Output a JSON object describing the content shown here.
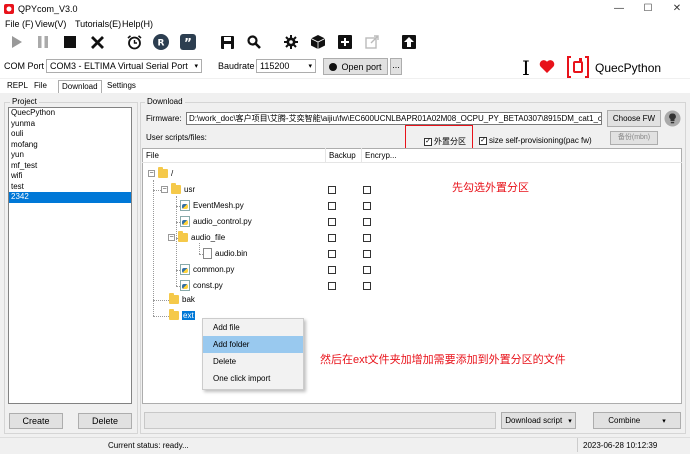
{
  "window": {
    "title": "QPYcom_V3.0",
    "controls": [
      "minimize-icon",
      "maximize-icon",
      "close-icon"
    ]
  },
  "menu": [
    "File (F)",
    "View(V)",
    "Tutorials(E)",
    "Help(H)"
  ],
  "toolbar": {
    "icons": [
      "run-icon",
      "pause-icon",
      "stop-icon",
      "clear-icon",
      "alarm-clock-icon",
      "terminal-icon",
      "quote-icon",
      "save-icon",
      "search-icon",
      "gear-icon",
      "cube-icon",
      "add-icon",
      "export-icon",
      "upload-icon"
    ]
  },
  "connection": {
    "com_port_label": "COM Port",
    "com_port_value": "COM3 - ELTIMA Virtual Serial Port",
    "baudrate_label": "Baudrate",
    "baudrate_value": "115200",
    "open_port_label": "Open port",
    "more_label": "..."
  },
  "brand": {
    "name": "QuecPython",
    "cursor_glyph": "I",
    "accent": "#e8121a"
  },
  "tabs": [
    "REPL",
    "File",
    "Download",
    "Settings"
  ],
  "active_tab": "Download",
  "project": {
    "group_title": "Project",
    "items": [
      "QuecPython",
      "yunma",
      "ouli",
      "mofang",
      "yun",
      "mf_test",
      "wifi",
      "test",
      "2342"
    ],
    "selected": "2342",
    "create_label": "Create",
    "delete_label": "Delete"
  },
  "download": {
    "group_title": "Download",
    "firmware_label": "Firmware:",
    "firmware_value": "D:\\work_doc\\客户项目\\艾腾-艾奕智能\\aijiu\\fw\\EC600UCNLBAPR01A02M08_OCPU_PY_BETA0307\\8915DM_cat1_open_EC",
    "choose_fw_label": "Choose FW",
    "user_scripts_label": "User scripts/files:",
    "external_partition_label": "外置分区",
    "external_partition_checked": true,
    "size_self_prov_label": "size self-provisioning(pac fw)",
    "size_self_prov_checked": true,
    "backup_btn_label": "备份(mbn)",
    "columns": [
      "File",
      "Backup",
      "Encryp..."
    ],
    "download_script_label": "Download script",
    "combine_label": "Combine"
  },
  "tree": {
    "root": "/",
    "usr": "usr",
    "files": [
      "EventMesh.py",
      "audio_control.py"
    ],
    "audio_file": "audio_file",
    "audio_bin": "audio.bin",
    "files2": [
      "common.py",
      "const.py"
    ],
    "bak": "bak",
    "ext": "ext"
  },
  "context_menu": {
    "items": [
      "Add file",
      "Add folder",
      "Delete",
      "One click import"
    ],
    "highlighted": "Add folder"
  },
  "annotations": {
    "first": "先勾选外置分区",
    "second": "然后在ext文件夹加增加需要添加到外置分区的文件"
  },
  "status": {
    "current": "Current status: ready...",
    "timestamp": "2023-06-28 10:12:39"
  }
}
